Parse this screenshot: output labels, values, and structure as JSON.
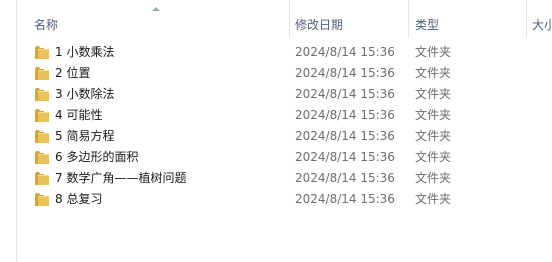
{
  "columns": {
    "name": "名称",
    "date": "修改日期",
    "type": "类型",
    "size": "大小"
  },
  "rows": [
    {
      "name": "1 小数乘法",
      "date": "2024/8/14 15:36",
      "type": "文件夹",
      "icon": "folder-icon"
    },
    {
      "name": "2 位置",
      "date": "2024/8/14 15:36",
      "type": "文件夹",
      "icon": "folder-icon"
    },
    {
      "name": "3 小数除法",
      "date": "2024/8/14 15:36",
      "type": "文件夹",
      "icon": "folder-icon"
    },
    {
      "name": "4 可能性",
      "date": "2024/8/14 15:36",
      "type": "文件夹",
      "icon": "folder-icon"
    },
    {
      "name": "5 简易方程",
      "date": "2024/8/14 15:36",
      "type": "文件夹",
      "icon": "folder-icon"
    },
    {
      "name": "6 多边形的面积",
      "date": "2024/8/14 15:36",
      "type": "文件夹",
      "icon": "folder-icon"
    },
    {
      "name": "7 数学广角——植树问题",
      "date": "2024/8/14 15:36",
      "type": "文件夹",
      "icon": "folder-icon"
    },
    {
      "name": "8 总复习",
      "date": "2024/8/14 15:36",
      "type": "文件夹",
      "icon": "folder-icon"
    }
  ],
  "colors": {
    "header_text": "#4c607a",
    "folder_yellow": "#e8c35a",
    "folder_dark": "#d3a63a"
  }
}
